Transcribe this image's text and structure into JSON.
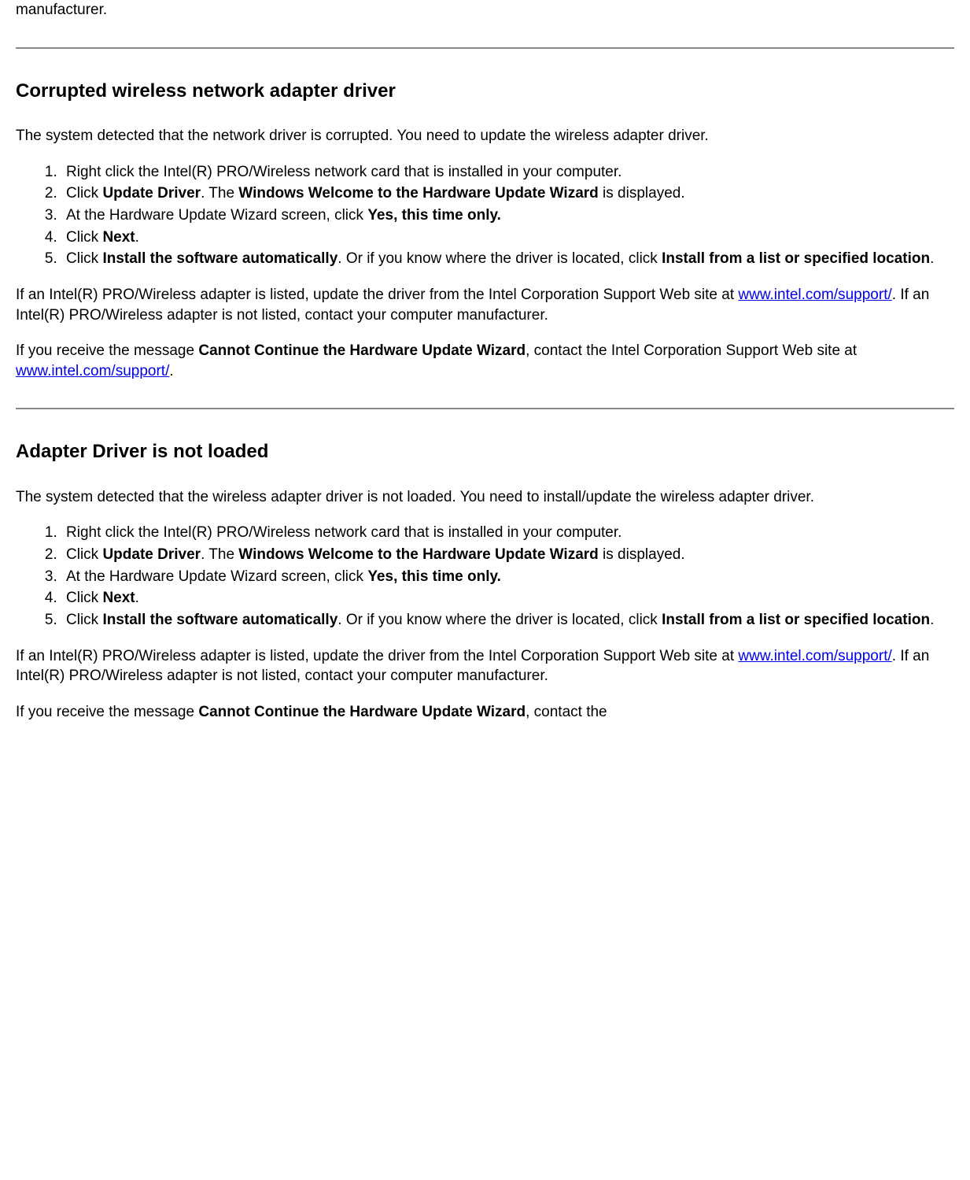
{
  "topFragment": "manufacturer.",
  "section1": {
    "heading": "Corrupted wireless network adapter driver",
    "intro": "The system detected that the network driver is corrupted. You need to update the wireless adapter driver.",
    "steps": {
      "s1": "Right click the Intel(R) PRO/Wireless network card that is installed in your computer.",
      "s2a": "Click ",
      "s2b": "Update Driver",
      "s2c": ". The ",
      "s2d": "Windows Welcome to the Hardware Update Wizard",
      "s2e": " is displayed.",
      "s3a": "At the Hardware Update Wizard screen, click ",
      "s3b": "Yes, this time only.",
      "s4a": "Click ",
      "s4b": "Next",
      "s4c": ".",
      "s5a": "Click ",
      "s5b": "Install the software automatically",
      "s5c": ". Or if you know where the driver is located, click ",
      "s5d": "Install from a list or specified location",
      "s5e": "."
    },
    "para2a": "If an Intel(R) PRO/Wireless adapter is listed, update the driver from the Intel Corporation Support Web site at ",
    "para2link": "www.intel.com/support/",
    "para2b": ". If an Intel(R) PRO/Wireless adapter is not listed, contact your computer manufacturer.",
    "para3a": "If you receive the message ",
    "para3b": "Cannot Continue the Hardware Update Wizard",
    "para3c": ", contact the Intel Corporation Support Web site at ",
    "para3link": "www.intel.com/support/",
    "para3d": "."
  },
  "section2": {
    "heading": "Adapter Driver is not loaded",
    "intro": "The system detected that the wireless adapter driver is not loaded. You need to install/update the wireless adapter driver.",
    "steps": {
      "s1": "Right click the Intel(R) PRO/Wireless network card that is installed in your computer.",
      "s2a": "Click ",
      "s2b": "Update Driver",
      "s2c": ". The ",
      "s2d": "Windows Welcome to the Hardware Update Wizard",
      "s2e": " is displayed.",
      "s3a": "At the Hardware Update Wizard screen, click ",
      "s3b": "Yes, this time only.",
      "s4a": "Click ",
      "s4b": "Next",
      "s4c": ".",
      "s5a": "Click ",
      "s5b": "Install the software automatically",
      "s5c": ". Or if you know where the driver is located, click ",
      "s5d": "Install from a list or specified location",
      "s5e": "."
    },
    "para2a": "If an Intel(R) PRO/Wireless adapter is listed, update the driver from the Intel Corporation Support Web site at ",
    "para2link": "www.intel.com/support/",
    "para2b": ". If an Intel(R) PRO/Wireless adapter is not listed, contact your computer manufacturer.",
    "para3a": "If you receive the message ",
    "para3b": "Cannot Continue the Hardware Update Wizard",
    "para3c": ", contact the"
  }
}
